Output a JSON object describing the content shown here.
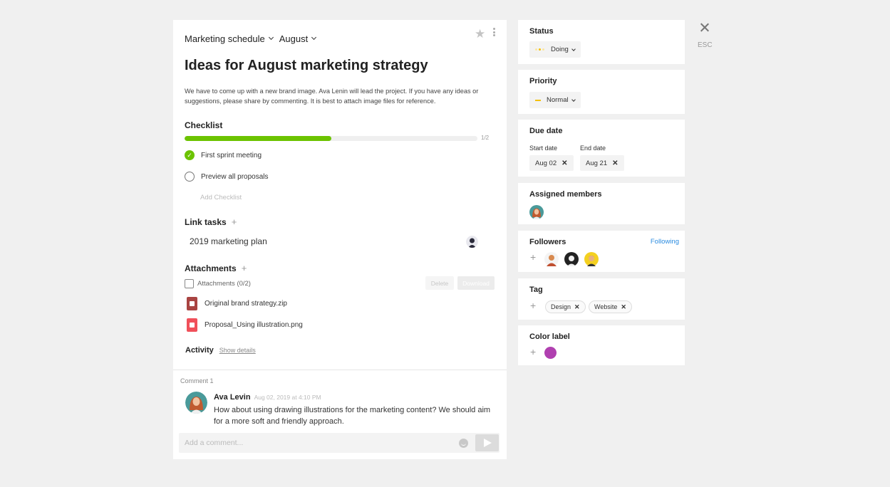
{
  "header": {
    "project": "Marketing schedule",
    "month": "August"
  },
  "task": {
    "title": "Ideas for August marketing strategy",
    "description": "We have to come up with a new brand image. Ava Lenin will lead the project. If you have any ideas or suggestions, please share by commenting. It is best to attach image files for reference."
  },
  "checklist": {
    "heading": "Checklist",
    "progress_fraction": 0.5,
    "count": "1/2",
    "items": [
      {
        "label": "First sprint meeting",
        "done": true
      },
      {
        "label": "Preview all proposals",
        "done": false
      }
    ],
    "add_label": "Add Checklist"
  },
  "link_tasks": {
    "heading": "Link tasks",
    "items": [
      {
        "label": "2019 marketing plan"
      }
    ]
  },
  "attachments": {
    "heading": "Attachments",
    "select_label": "Attachments (0/2)",
    "delete_label": "Delete",
    "download_label": "Download",
    "files": [
      {
        "name": "Original brand strategy.zip",
        "color": "#a94442"
      },
      {
        "name": "Proposal_Using illustration.png",
        "color": "#f0505a"
      }
    ]
  },
  "activity": {
    "heading": "Activity",
    "show_details": "Show details"
  },
  "comments": {
    "label": "Comment 1",
    "items": [
      {
        "author": "Ava Levin",
        "timestamp": "Aug 02, 2019 at 4:10 PM",
        "text": "How about using drawing illustrations for the marketing content? We should aim for a more soft and friendly approach."
      }
    ],
    "input_placeholder": "Add a comment..."
  },
  "sidebar": {
    "status": {
      "title": "Status",
      "value": "Doing",
      "dot_colors": [
        "#fbe6a0",
        "#f4c000",
        "#fbe6a0"
      ]
    },
    "priority": {
      "title": "Priority",
      "value": "Normal",
      "color": "#f4c000"
    },
    "due_date": {
      "title": "Due date",
      "start_label": "Start date",
      "end_label": "End date",
      "start_value": "Aug 02",
      "end_value": "Aug 21"
    },
    "assigned": {
      "title": "Assigned members"
    },
    "followers": {
      "title": "Followers",
      "following_label": "Following"
    },
    "tag": {
      "title": "Tag",
      "items": [
        "Design",
        "Website"
      ]
    },
    "color_label": {
      "title": "Color label",
      "color": "#b040b0"
    }
  },
  "close": {
    "esc_label": "ESC"
  },
  "colors": {
    "accent_green": "#6cc300",
    "link_blue": "#2a8be0",
    "background": "#f0f0f0"
  }
}
